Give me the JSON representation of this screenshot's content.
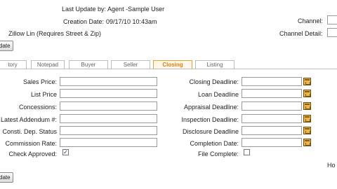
{
  "header": {
    "last_update": "Last Update by: Agent -Sample User",
    "creation_label": "Creation Date:",
    "creation_value": "09/17/10 10:43am",
    "zillow": "Zillow Lin (Requires Street & Zip)",
    "channel": "Channel:",
    "channel_detail": "Channel Detail:"
  },
  "buttons": {
    "top_update": "date",
    "bottom_update": "date"
  },
  "tabs": [
    {
      "label": "tory"
    },
    {
      "label": "Notepad"
    },
    {
      "label": "Buyer"
    },
    {
      "label": "Seller"
    },
    {
      "label": "Closing"
    },
    {
      "label": "Listing"
    }
  ],
  "left_fields": [
    {
      "label": "Sales Price:",
      "value": ""
    },
    {
      "label": "List Price",
      "value": ""
    },
    {
      "label": "Concessions:",
      "value": ""
    },
    {
      "label": "Latest Addendum #:",
      "value": ""
    },
    {
      "label": "Consti. Dep. Status",
      "value": ""
    },
    {
      "label": "Commission Rate:",
      "value": ""
    }
  ],
  "right_fields": [
    {
      "label": "Closing Deadline:",
      "value": ""
    },
    {
      "label": "Loan Deadline",
      "value": ""
    },
    {
      "label": "Appraisal Deadline:",
      "value": ""
    },
    {
      "label": "Inspection Deadline:",
      "value": ""
    },
    {
      "label": "Disclosure Deadline",
      "value": ""
    },
    {
      "label": "Completion Date:",
      "value": ""
    }
  ],
  "checks": {
    "check_approved": {
      "label": "Check Approved:",
      "checked": true
    },
    "file_complete": {
      "label": "File Complete:",
      "checked": false
    }
  },
  "edge_text": "Ho"
}
